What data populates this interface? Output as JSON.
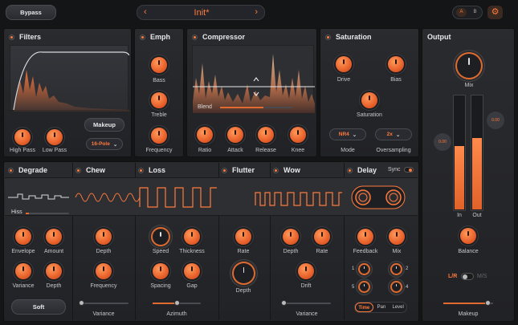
{
  "top": {
    "bypass": "Bypass",
    "preset": "Init*",
    "prev_icon": "‹",
    "next_icon": "›",
    "a": "A",
    "b": "B",
    "gear": "⚙"
  },
  "filters": {
    "title": "Filters",
    "high_pass": "High Pass",
    "low_pass": "Low Pass",
    "makeup": "Makeup",
    "pole": "16-Pole"
  },
  "emph": {
    "title": "Emph",
    "bass": "Bass",
    "treble": "Treble",
    "frequency": "Frequency"
  },
  "compressor": {
    "title": "Compressor",
    "blend": "Blend",
    "blend_level": 0.6,
    "ratio": "Ratio",
    "attack": "Attack",
    "release": "Release",
    "knee": "Knee"
  },
  "saturation": {
    "title": "Saturation",
    "drive": "Drive",
    "bias": "Bias",
    "saturation": "Saturation",
    "mode": "Mode",
    "mode_value": "NR4",
    "oversampling": "Oversampling",
    "oversampling_value": "2x"
  },
  "output": {
    "title": "Output",
    "mix": "Mix",
    "in": "In",
    "out": "Out",
    "in_readout": "0.00",
    "out_readout": "0.00",
    "in_level": 0.55,
    "out_level": 0.62,
    "balance": "Balance",
    "lr": "L/R",
    "ms": "M/S",
    "makeup": "Makeup",
    "makeup_level": 0.9
  },
  "modules": {
    "degrade": "Degrade",
    "chew": "Chew",
    "loss": "Loss",
    "flutter": "Flutter",
    "wow": "Wow",
    "delay": "Delay",
    "sync": "Sync"
  },
  "degrade": {
    "hiss": "Hiss",
    "envelope": "Envelope",
    "amount": "Amount",
    "variance": "Variance",
    "depth": "Depth",
    "soft": "Soft"
  },
  "chew": {
    "depth": "Depth",
    "frequency": "Frequency",
    "variance": "Variance"
  },
  "loss": {
    "speed": "Speed",
    "thickness": "Thickness",
    "spacing": "Spacing",
    "gap": "Gap",
    "azimuth": "Azimuth"
  },
  "flutter": {
    "rate": "Rate",
    "depth": "Depth"
  },
  "wow": {
    "depth": "Depth",
    "rate": "Rate",
    "drift": "Drift",
    "variance": "Variance"
  },
  "delay": {
    "feedback": "Feedback",
    "mix": "Mix",
    "n1": "1",
    "n2": "2",
    "n3": "3",
    "n4": "4",
    "n5": "5",
    "tabs": [
      "Time",
      "Pan",
      "Level"
    ]
  }
}
